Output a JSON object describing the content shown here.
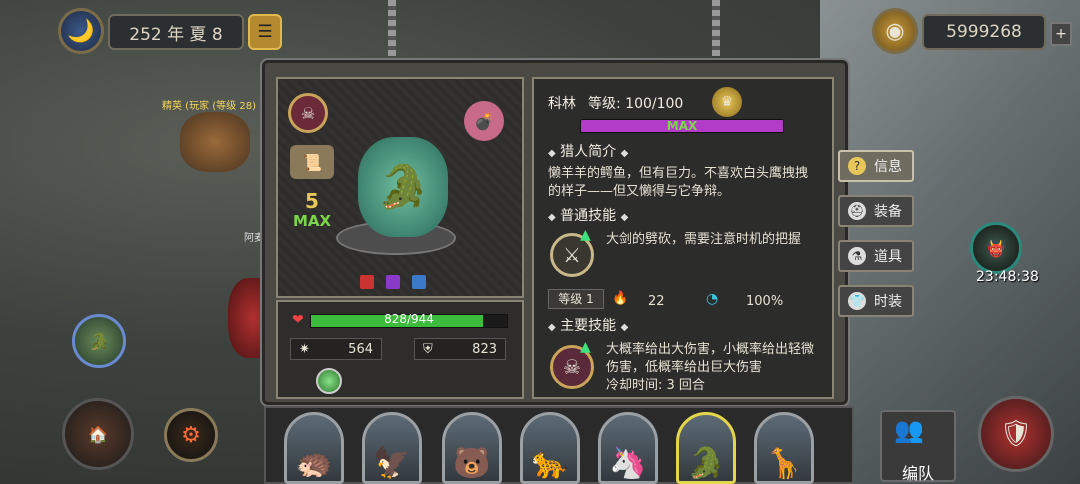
{
  "top": {
    "date": "252 年 夏 8",
    "gold": "5999268"
  },
  "map_labels": {
    "enemy1": "精英 (玩家 (等级 28)",
    "enemy2": "阿麦利",
    "timer": "23:48:38"
  },
  "hero": {
    "stars": "5",
    "max_badge": "MAX",
    "hp": "828/944",
    "hp_fraction": 0.877,
    "attack": "564",
    "defense": "823"
  },
  "info": {
    "name": "科林",
    "level_label": "等级: 100/100",
    "exp_badge": "MAX",
    "bio_title": "猎人简介",
    "bio": "懒羊羊的鳄鱼，但有巨力。不喜欢白头鹰拽拽的样子——但又懒得与它争辩。",
    "skill1_title": "普通技能",
    "skill1_desc": "大剑的劈砍，需要注意时机的把握",
    "skill1_level": "等级 1",
    "skill1_cost": "22",
    "skill1_rate": "100%",
    "skill2_title": "主要技能",
    "skill2_desc": "大概率给出大伤害，小概率给出轻微伤害，低概率给出巨大伤害",
    "skill2_cd": "冷却时间: 3 回合"
  },
  "side_tabs": [
    "信息",
    "装备",
    "道具",
    "时装"
  ],
  "bottom": {
    "formation": "编队"
  },
  "colors": {
    "hp_green": "#3dbb3d",
    "exp_purple": "#b23cc8",
    "max_green": "#7cd64a",
    "gold_accent": "#e8c75a"
  }
}
